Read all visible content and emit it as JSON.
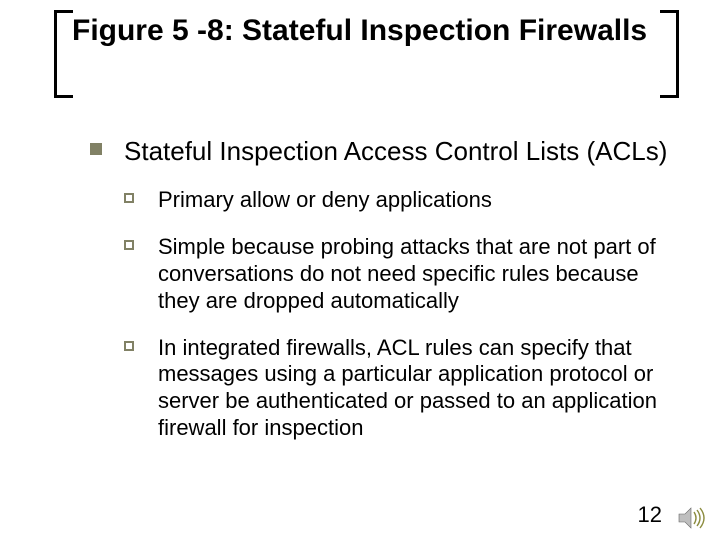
{
  "title": "Figure 5 -8: Stateful Inspection Firewalls",
  "lvl1_text": "Stateful Inspection Access Control Lists (ACLs)",
  "sub": [
    "Primary allow or deny applications",
    "Simple because probing attacks that are not part of conversations do not need specific rules because they are dropped automatically",
    "In integrated firewalls, ACL rules can specify that messages using a particular application protocol or server be authenticated or passed to an application firewall for inspection"
  ],
  "page_number": "12",
  "colors": {
    "accent": "#818165"
  }
}
